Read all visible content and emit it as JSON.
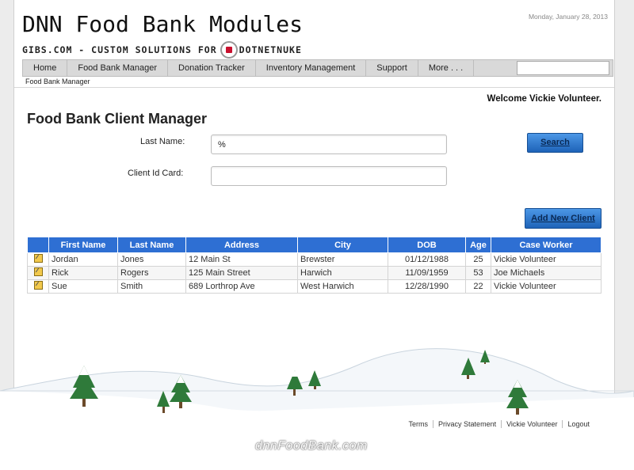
{
  "header": {
    "title": "DNN Food Bank Modules",
    "subtitle": "GIBS.COM - CUSTOM SOLUTIONS FOR",
    "brand": "DOTNETNUKE",
    "date": "Monday, January 28, 2013"
  },
  "nav": {
    "items": [
      {
        "label": "Home"
      },
      {
        "label": "Food Bank Manager"
      },
      {
        "label": "Donation Tracker"
      },
      {
        "label": "Inventory Management"
      },
      {
        "label": "Support"
      },
      {
        "label": "More . . ."
      }
    ],
    "search_value": ""
  },
  "breadcrumb": "Food Bank Manager",
  "welcome": "Welcome Vickie Volunteer.",
  "page_title": "Food Bank Client Manager",
  "form": {
    "last_name_label": "Last Name:",
    "last_name_value": "%",
    "client_id_label": "Client Id Card:",
    "client_id_value": "",
    "search_button": "Search",
    "add_button": "Add New Client"
  },
  "grid": {
    "columns": [
      "",
      "First Name",
      "Last Name",
      "Address",
      "City",
      "DOB",
      "Age",
      "Case Worker"
    ],
    "rows": [
      {
        "first": "Jordan",
        "last": "Jones",
        "address": "12 Main St",
        "city": "Brewster",
        "dob": "01/12/1988",
        "age": "25",
        "worker": "Vickie Volunteer"
      },
      {
        "first": "Rick",
        "last": "Rogers",
        "address": "125 Main Street",
        "city": "Harwich",
        "dob": "11/09/1959",
        "age": "53",
        "worker": "Joe Michaels"
      },
      {
        "first": "Sue",
        "last": "Smith",
        "address": "689 Lorthrop Ave",
        "city": "West Harwich",
        "dob": "12/28/1990",
        "age": "22",
        "worker": "Vickie Volunteer"
      }
    ]
  },
  "footer": {
    "links": [
      "Terms",
      "Privacy Statement",
      "Vickie Volunteer",
      "Logout"
    ],
    "watermark": "dnnFoodBank.com"
  },
  "colors": {
    "accent": "#2e6fd3",
    "button": "#1e63b8",
    "tree": "#2f7a3a"
  },
  "icons": {
    "edit": "edit-icon",
    "search": "search-icon",
    "logo": "dotnetnuke-logo"
  }
}
